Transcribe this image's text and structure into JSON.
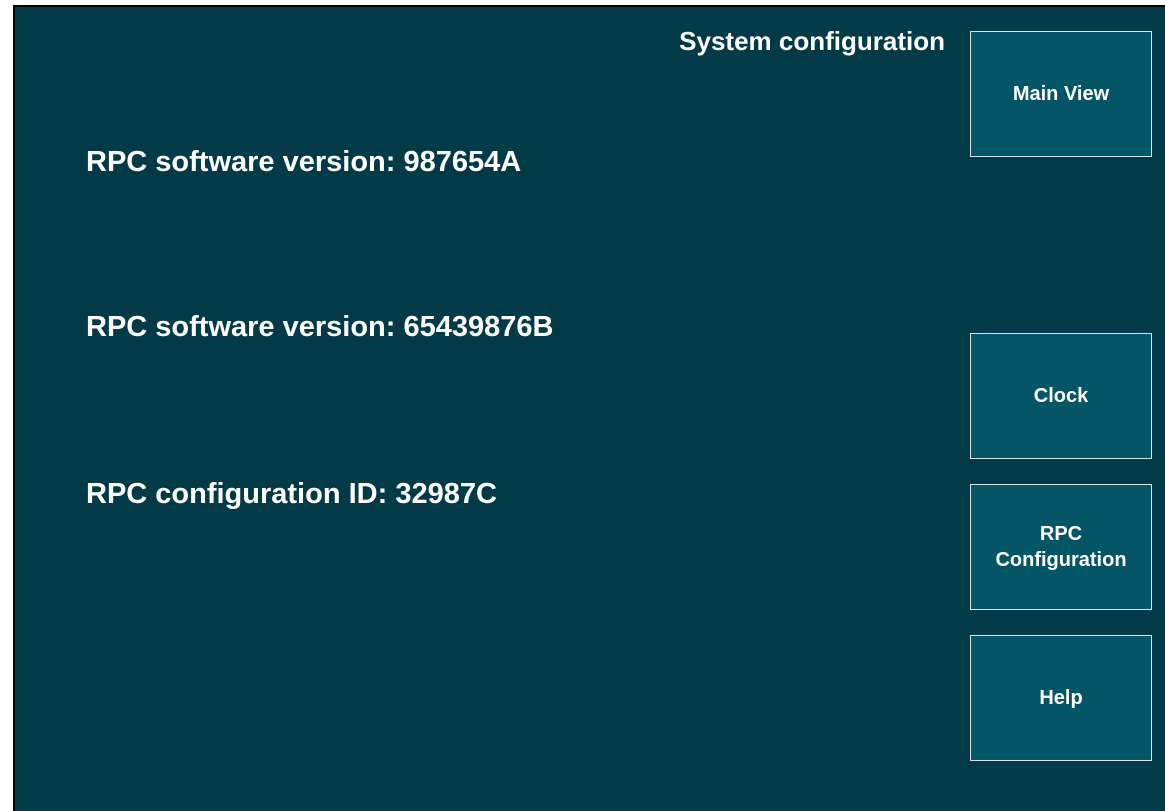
{
  "header": {
    "title": "System configuration"
  },
  "info": {
    "line1": "RPC software version: 987654A",
    "line2": "RPC software version: 65439876B",
    "line3": "RPC configuration ID: 32987C"
  },
  "nav": {
    "main_view": "Main View",
    "clock": "Clock",
    "rpc_configuration": "RPC\nConfiguration",
    "help": "Help"
  },
  "colors": {
    "background": "#033a48",
    "button": "#045565",
    "button_border": "#d9e4e8",
    "text": "#ffffff"
  }
}
